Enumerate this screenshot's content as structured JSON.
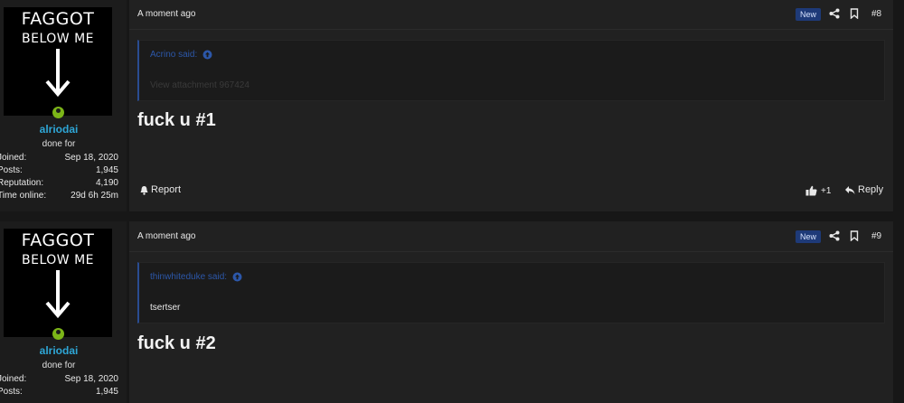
{
  "posts": [
    {
      "user": {
        "avatar_line1": "FAGGOT",
        "avatar_line2": "BELOW ME",
        "name": "alriodai",
        "title": "done for",
        "stats": [
          {
            "label": "Joined:",
            "value": "Sep 18, 2020"
          },
          {
            "label": "Posts:",
            "value": "1,945"
          },
          {
            "label": "Reputation:",
            "value": "4,190"
          },
          {
            "label": "Time online:",
            "value": "29d 6h 25m"
          }
        ]
      },
      "time": "A moment ago",
      "badge": "New",
      "number": "#8",
      "quote": {
        "author": "Acrino said:",
        "body": "View attachment 967424"
      },
      "body": "fuck u #1",
      "report_label": "Report",
      "like_label": "+1",
      "reply_label": "Reply"
    },
    {
      "user": {
        "avatar_line1": "FAGGOT",
        "avatar_line2": "BELOW ME",
        "name": "alriodai",
        "title": "done for",
        "stats": [
          {
            "label": "Joined:",
            "value": "Sep 18, 2020"
          },
          {
            "label": "Posts:",
            "value": "1,945"
          }
        ]
      },
      "time": "A moment ago",
      "badge": "New",
      "number": "#9",
      "quote": {
        "author": "thinwhiteduke said:",
        "body": "tsertser"
      },
      "body": "fuck u #2"
    }
  ],
  "colors": {
    "accent": "#2ea6d6",
    "quote_link": "#2c57a9",
    "online": "#7cb518",
    "badge_bg": "#1e3a78"
  },
  "icons": [
    "share-icon",
    "bookmark-icon",
    "arrow-circle-up-icon",
    "bell-icon",
    "thumbs-up-icon",
    "reply-icon"
  ]
}
